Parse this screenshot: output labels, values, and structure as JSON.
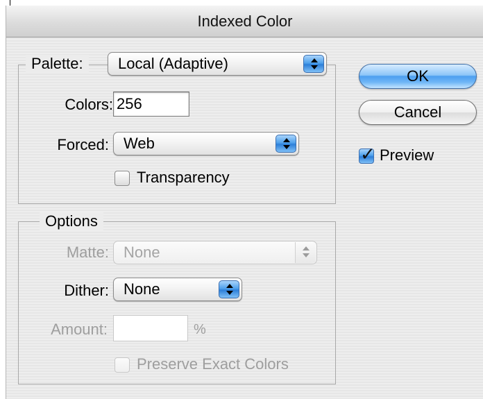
{
  "window": {
    "title": "Indexed Color"
  },
  "palette_group": {
    "palette_label": "Palette:",
    "palette_value": "Local (Adaptive)",
    "colors_label": "Colors:",
    "colors_value": "256",
    "forced_label": "Forced:",
    "forced_value": "Web",
    "transparency_label": "Transparency",
    "transparency_checked": false
  },
  "options_group": {
    "title": "Options",
    "matte_label": "Matte:",
    "matte_value": "None",
    "dither_label": "Dither:",
    "dither_value": "None",
    "amount_label": "Amount:",
    "amount_value": "",
    "amount_unit": "%",
    "preserve_label": "Preserve Exact Colors",
    "preserve_checked": false
  },
  "buttons": {
    "ok": "OK",
    "cancel": "Cancel"
  },
  "preview": {
    "label": "Preview",
    "checked": true
  },
  "colors": {
    "accent_blue": "#4d9ff0",
    "disabled_text": "#9e9e9e"
  }
}
